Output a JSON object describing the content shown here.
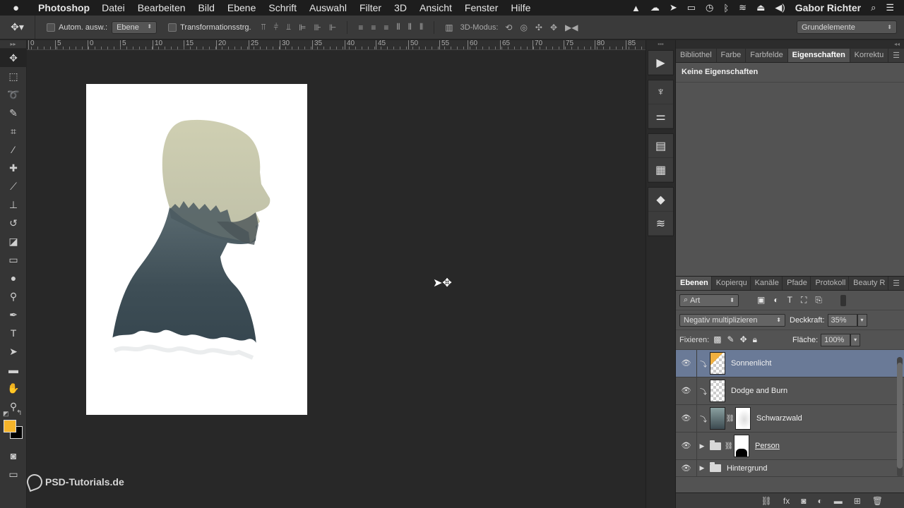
{
  "menubar": {
    "apple": "",
    "app_name": "Photoshop",
    "items": [
      "Datei",
      "Bearbeiten",
      "Bild",
      "Ebene",
      "Schrift",
      "Auswahl",
      "Filter",
      "3D",
      "Ansicht",
      "Fenster",
      "Hilfe"
    ],
    "user": "Gabor Richter"
  },
  "options": {
    "auto_select_label": "Autom. ausw.:",
    "auto_select_value": "Ebene",
    "transform_label": "Transformationsstrg.",
    "mode_3d_label": "3D-Modus:",
    "workspace": "Grundelemente"
  },
  "ruler": {
    "ticks": [
      "0",
      "5",
      "0",
      "5",
      "10",
      "15",
      "20",
      "25",
      "30",
      "35",
      "40",
      "45",
      "50",
      "55",
      "60",
      "65",
      "70",
      "75",
      "80",
      "85"
    ]
  },
  "watermark": "PSD-Tutorials.de",
  "properties": {
    "tabs": [
      "Bibliothel",
      "Farbe",
      "Farbfelde",
      "Eigenschaften",
      "Korrektu"
    ],
    "active_tab": "Eigenschaften",
    "title": "Keine Eigenschaften"
  },
  "layers_panel": {
    "tabs": [
      "Ebenen",
      "Kopierqu",
      "Kanäle",
      "Pfade",
      "Protokoll",
      "Beauty R"
    ],
    "active_tab": "Ebenen",
    "filter": "Art",
    "blend_mode": "Negativ multiplizieren",
    "opacity_label": "Deckkraft:",
    "opacity": "35%",
    "lock_label": "Fixieren:",
    "fill_label": "Fläche:",
    "fill": "100%",
    "layers": [
      {
        "name": "Sonnenlicht",
        "selected": true
      },
      {
        "name": "Dodge and Burn",
        "selected": false
      },
      {
        "name": "Schwarzwald",
        "selected": false
      },
      {
        "name": "Person",
        "selected": false
      },
      {
        "name": "Hintergrund",
        "selected": false
      }
    ]
  },
  "colors": {
    "foreground": "#f5b42a",
    "background": "#000000",
    "selected_layer": "#6a7a97"
  }
}
